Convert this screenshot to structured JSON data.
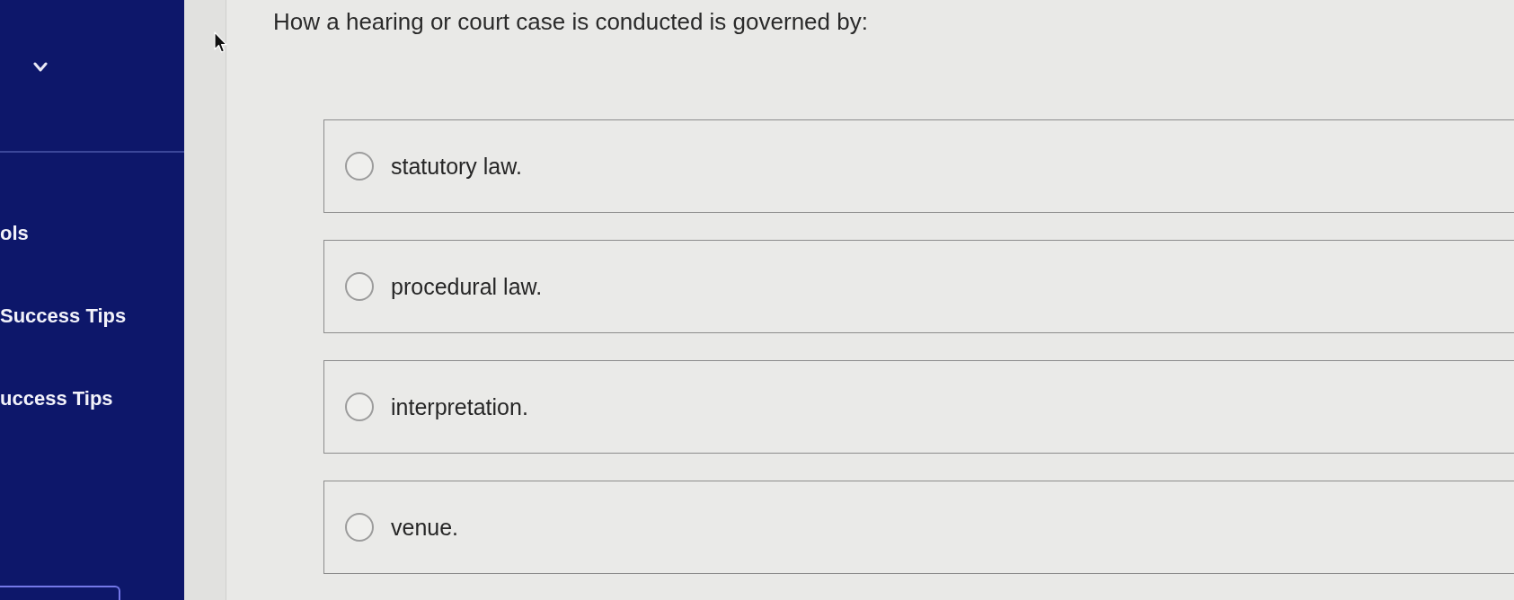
{
  "sidebar": {
    "items": [
      {
        "label": "ols"
      },
      {
        "label": "Success Tips"
      },
      {
        "label": "uccess Tips"
      }
    ]
  },
  "question": {
    "text": "How a hearing or court case is conducted is governed by:",
    "options": [
      {
        "label": "statutory law.",
        "selected": false
      },
      {
        "label": "procedural law.",
        "selected": false
      },
      {
        "label": "interpretation.",
        "selected": false
      },
      {
        "label": "venue.",
        "selected": false
      }
    ]
  }
}
